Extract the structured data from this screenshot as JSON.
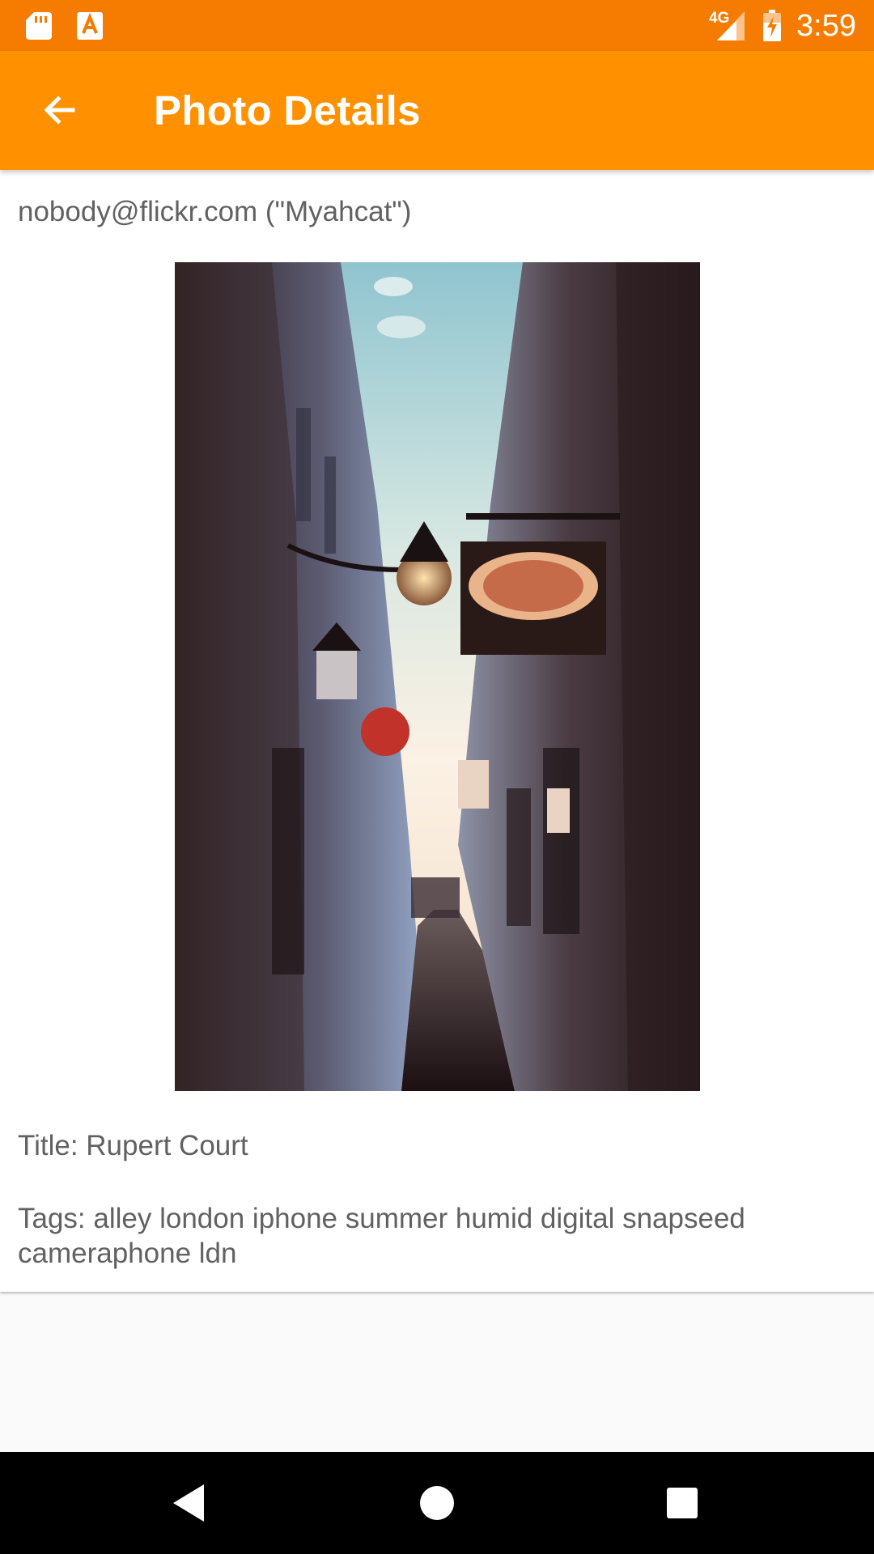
{
  "status_bar": {
    "time": "3:59",
    "network": "4G",
    "icons": [
      "sd-card-icon",
      "text-a-icon",
      "signal-icon",
      "battery-charging-icon"
    ]
  },
  "app_bar": {
    "title": "Photo Details",
    "back_icon": "arrow-back-icon"
  },
  "photo": {
    "owner": "nobody@flickr.com (\"Myahcat\")",
    "title": "Title: Rupert Court",
    "tags": "Tags: alley london iphone summer humid digital snapseed cameraphone ldn"
  },
  "nav_bar": {
    "buttons": [
      "back-triangle-icon",
      "home-circle-icon",
      "recents-square-icon"
    ]
  },
  "colors": {
    "status_bar": "#F57C00",
    "app_bar": "#FF9100",
    "text": "#616161"
  }
}
